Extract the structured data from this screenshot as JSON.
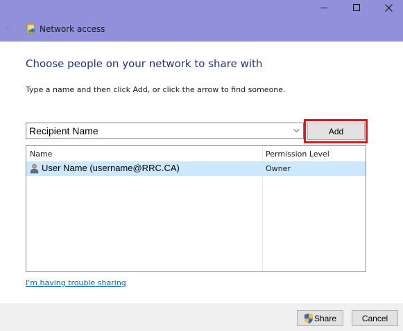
{
  "window": {
    "title": "Network access"
  },
  "icons": {
    "back": "back-arrow-icon",
    "app": "network-share-icon",
    "user": "user-icon",
    "shield": "uac-shield-icon"
  },
  "heading": "Choose people on your network to share with",
  "instructions": "Type a name and then click Add, or click the arrow to find someone.",
  "recipient": {
    "value": "Recipient Name"
  },
  "add_label": "Add",
  "list": {
    "columns": [
      "Name",
      "Permission Level"
    ],
    "rows": [
      {
        "name": "User Name (username@RRC.CA)",
        "permission": "Owner",
        "selected": true
      }
    ]
  },
  "trouble_link": "I'm having trouble sharing",
  "footer": {
    "share_label": "Share",
    "cancel_label": "Cancel"
  },
  "colors": {
    "titlebar": "#9191db",
    "heading": "#1e3287",
    "link": "#0066cc",
    "highlight": "#e0161b",
    "selection": "#cce8ff"
  }
}
